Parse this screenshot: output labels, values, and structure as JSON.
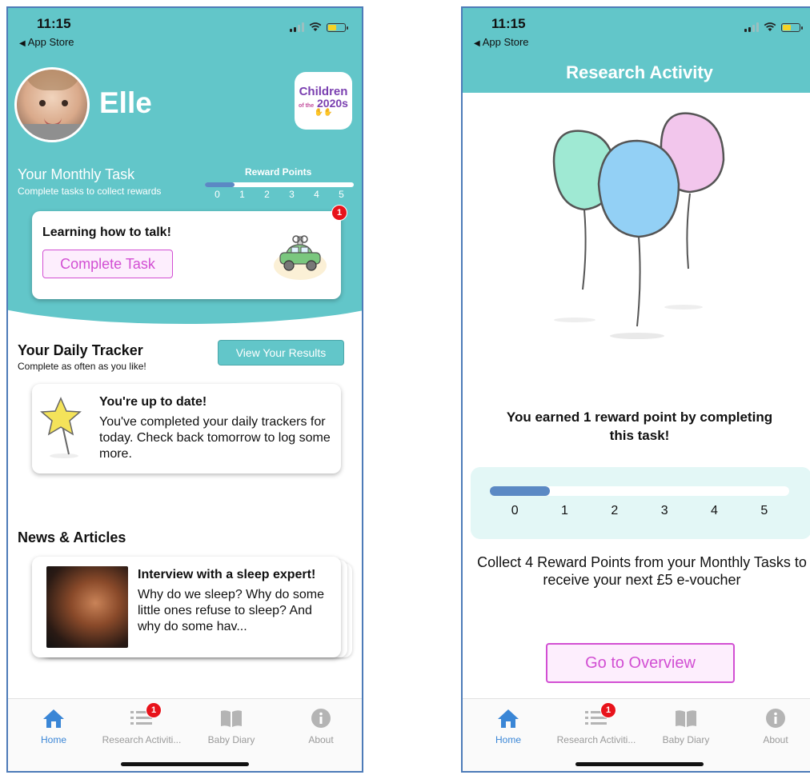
{
  "status": {
    "time": "11:15",
    "back_label": "App Store"
  },
  "home": {
    "baby_name": "Elle",
    "logo": {
      "line1": "Children",
      "line2_small": "of the",
      "line2": "2020s"
    },
    "monthly": {
      "title": "Your Monthly Task",
      "subtitle": "Complete tasks to collect rewards",
      "reward_label": "Reward Points",
      "ticks": [
        "0",
        "1",
        "2",
        "3",
        "4",
        "5"
      ],
      "progress_fraction": 0.2
    },
    "task_card": {
      "title": "Learning how to talk!",
      "button_label": "Complete Task",
      "badge": "1"
    },
    "tracker": {
      "title": "Your Daily Tracker",
      "subtitle": "Complete as often as you like!",
      "button_label": "View Your Results",
      "card_title": "You're up to date!",
      "card_text": "You've completed your daily trackers for today.  Check back tomorrow to log some more."
    },
    "news": {
      "title": "News & Articles",
      "card_title": "Interview with a sleep expert!",
      "card_text": "Why do we sleep? Why do some little ones refuse to sleep? And why do some hav..."
    }
  },
  "activity": {
    "header_title": "Research Activity",
    "earned_text": "You earned 1 reward point by completing this task!",
    "ticks": [
      "0",
      "1",
      "2",
      "3",
      "4",
      "5"
    ],
    "progress_fraction": 0.2,
    "collect_text": "Collect 4 Reward Points from your Monthly Tasks to receive your next £5 e-voucher",
    "button_label": "Go to Overview"
  },
  "tabs": [
    {
      "label": "Home",
      "icon": "home-icon",
      "active": true
    },
    {
      "label": "Research Activiti...",
      "icon": "list-icon",
      "badge": "1"
    },
    {
      "label": "Baby Diary",
      "icon": "book-icon"
    },
    {
      "label": "About",
      "icon": "info-icon"
    }
  ],
  "colors": {
    "teal": "#62c6c9",
    "accent_pink": "#d24fd3",
    "progress_blue": "#5b89c4",
    "tab_active": "#3a86d6",
    "badge_red": "#e8131b"
  }
}
